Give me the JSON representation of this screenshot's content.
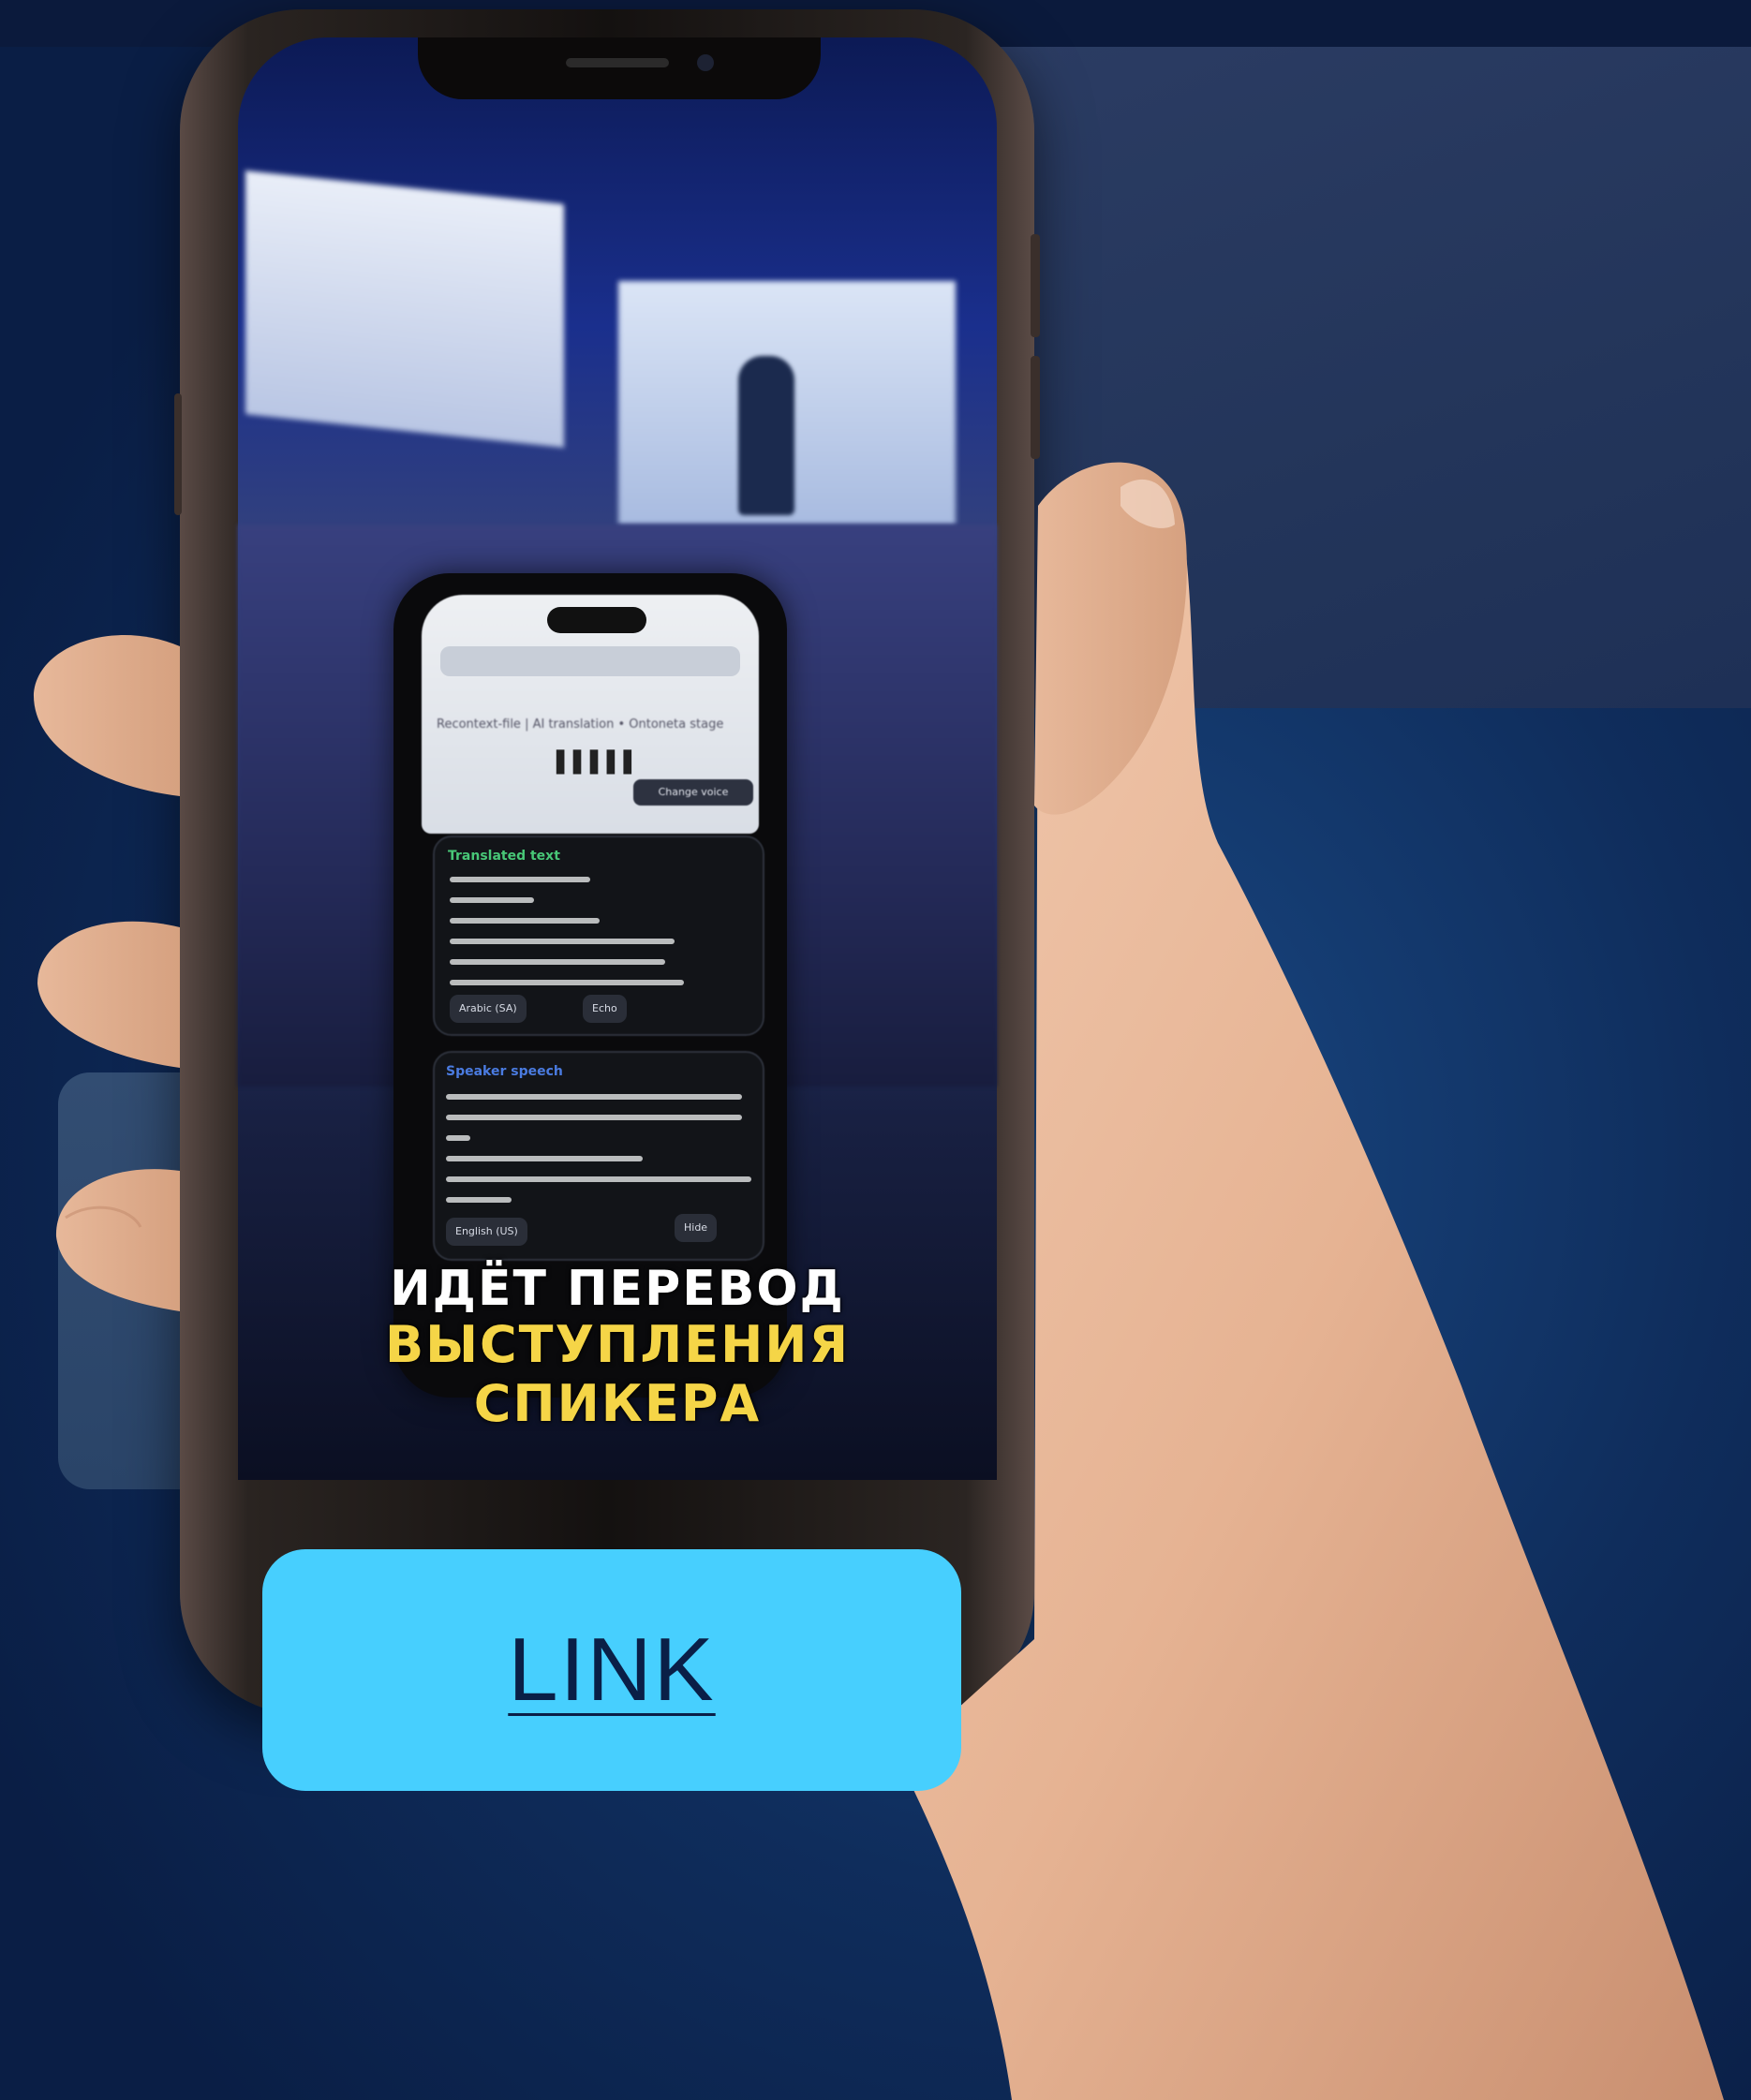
{
  "screen": {
    "inner_app": {
      "page_title": "Recontext-file | AI translation • Ontoneta stage",
      "audio_bars": "▌▌▌▌▌",
      "change_voice_chip": "Change voice",
      "translated_card": {
        "title": "Translated text",
        "language_chip": "Arabic (SA)",
        "mode_chip": "Echo"
      },
      "speaker_card": {
        "title": "Speaker speech",
        "language_chip": "English (US)",
        "hide_chip": "Hide"
      }
    },
    "caption": {
      "line1": "ИДЁТ ПЕРЕВОД",
      "line2": "ВЫСТУПЛЕНИЯ СПИКЕРА"
    }
  },
  "link_button": {
    "label": "LINK",
    "color": "#47cffe"
  },
  "colors": {
    "background": "#0f2d5c",
    "caption_line1": "#ffffff",
    "caption_line2": "#f5d547"
  }
}
